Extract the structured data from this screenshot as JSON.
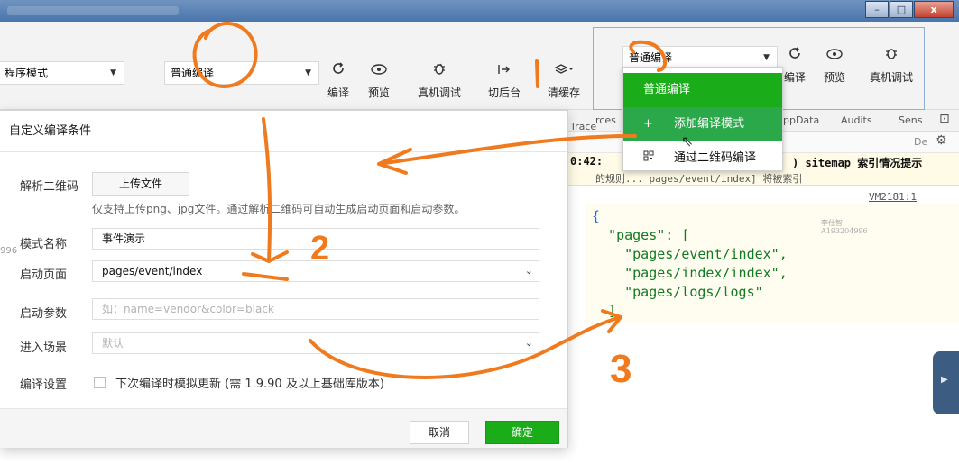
{
  "window": {
    "minimize": "–",
    "maximize": "□",
    "close": "x"
  },
  "toolbar": {
    "mode_select": "程序模式",
    "compile_select": "普通编译",
    "buttons": [
      {
        "label": "编译"
      },
      {
        "label": "预览"
      },
      {
        "label": "真机调试"
      },
      {
        "label": "切后台"
      },
      {
        "label": "清缓存"
      }
    ]
  },
  "overlay": {
    "compile_select": "普通编译",
    "buttons": [
      {
        "label": "编译"
      },
      {
        "label": "预览"
      },
      {
        "label": "真机调试"
      }
    ],
    "dropdown": {
      "items": [
        {
          "label": "普通编译"
        },
        {
          "prefix": "+",
          "label": "添加编译模式"
        },
        {
          "label": "通过二维码编译"
        }
      ]
    }
  },
  "devtools": {
    "tabs": [
      "rces",
      "Trace",
      "ppData",
      "Audits",
      "Sens"
    ],
    "filter_hint": "De",
    "console_text": "0:42:",
    "console_text2": ") sitemap 索引情况提示",
    "console_text3": "的规则... pages/event/index] 将被索引",
    "console_ref": "VM2181:1",
    "side_number": "996",
    "json_lines": [
      "{",
      "  \"pages\": [",
      "    \"pages/event/index\",",
      "    \"pages/index/index\",",
      "    \"pages/logs/logs\"",
      "  ]"
    ]
  },
  "dialog": {
    "title": "自定义编译条件",
    "qrcode_label": "解析二维码",
    "upload_button": "上传文件",
    "upload_hint": "仅支持上传png、jpg文件。通过解析二维码可自动生成启动页面和启动参数。",
    "mode_name_label": "模式名称",
    "mode_name_value": "事件演示",
    "start_page_label": "启动页面",
    "start_page_value": "pages/event/index",
    "start_params_label": "启动参数",
    "start_params_placeholder": "如：name=vendor&color=black",
    "scene_label": "进入场景",
    "scene_placeholder": "默认",
    "compile_settings_label": "编译设置",
    "compile_settings_checkbox": "下次编译时模拟更新 (需 1.9.90 及以上基础库版本)",
    "side_number": "996",
    "cancel_button": "取消",
    "ok_button": "确定"
  },
  "watermark": {
    "name": "李仕智",
    "id": "A193204996"
  },
  "annotations": {
    "num1": "1",
    "num2": "2",
    "num3": "3"
  },
  "colors": {
    "accent_green": "#1aad19",
    "annotation_orange": "#f07a1e",
    "titlebar": "#4a75ab"
  }
}
